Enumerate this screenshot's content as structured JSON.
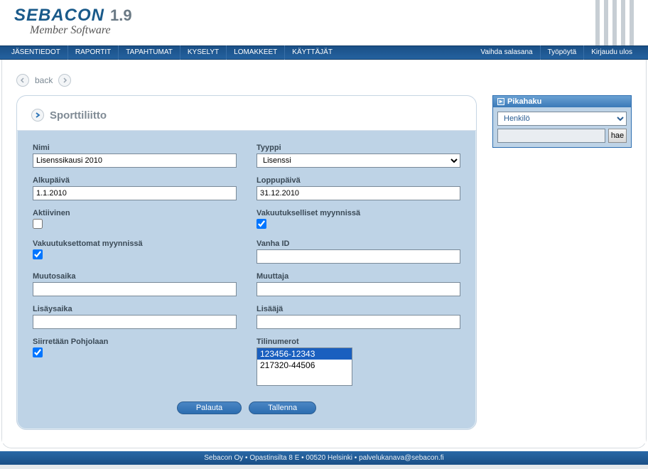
{
  "logo": {
    "name": "SEBACON",
    "version": "1.9",
    "subtitle": "Member Software"
  },
  "nav": {
    "left": [
      "JÄSENTIEDOT",
      "RAPORTIT",
      "TAPAHTUMAT",
      "KYSELYT",
      "LOMAKKEET",
      "KÄYTTÄJÄT"
    ],
    "right": [
      "Vaihda salasana",
      "Työpöytä",
      "Kirjaudu ulos"
    ]
  },
  "back_label": "back",
  "panel_title": "Sporttiliitto",
  "fields": {
    "nimi": {
      "label": "Nimi",
      "value": "Lisenssikausi 2010"
    },
    "tyyppi": {
      "label": "Tyyppi",
      "value": "Lisenssi"
    },
    "alkupaiva": {
      "label": "Alkupäivä",
      "value": "1.1.2010"
    },
    "loppupaiva": {
      "label": "Loppupäivä",
      "value": "31.12.2010"
    },
    "aktiivinen": {
      "label": "Aktiivinen",
      "checked": false
    },
    "vakuutukselliset": {
      "label": "Vakuutukselliset myynnissä",
      "checked": true
    },
    "vakuutuksettomat": {
      "label": "Vakuutuksettomat myynnissä",
      "checked": true
    },
    "vanha_id": {
      "label": "Vanha ID",
      "value": ""
    },
    "muutosaika": {
      "label": "Muutosaika",
      "value": ""
    },
    "muuttaja": {
      "label": "Muuttaja",
      "value": ""
    },
    "lisaysaika": {
      "label": "Lisäysaika",
      "value": ""
    },
    "lisaaja": {
      "label": "Lisääjä",
      "value": ""
    },
    "siirretaan": {
      "label": "Siirretään Pohjolaan",
      "checked": true
    },
    "tilinumerot": {
      "label": "Tilinumerot",
      "options": [
        "123456-12343",
        "217320-44506"
      ],
      "selected": 0
    }
  },
  "buttons": {
    "reset": "Palauta",
    "save": "Tallenna"
  },
  "quicksearch": {
    "title": "Pikahaku",
    "type": "Henkilö",
    "query": "",
    "button": "hae"
  },
  "footer": "Sebacon Oy • Opastinsilta 8 E • 00520 Helsinki • palvelukanava@sebacon.fi"
}
